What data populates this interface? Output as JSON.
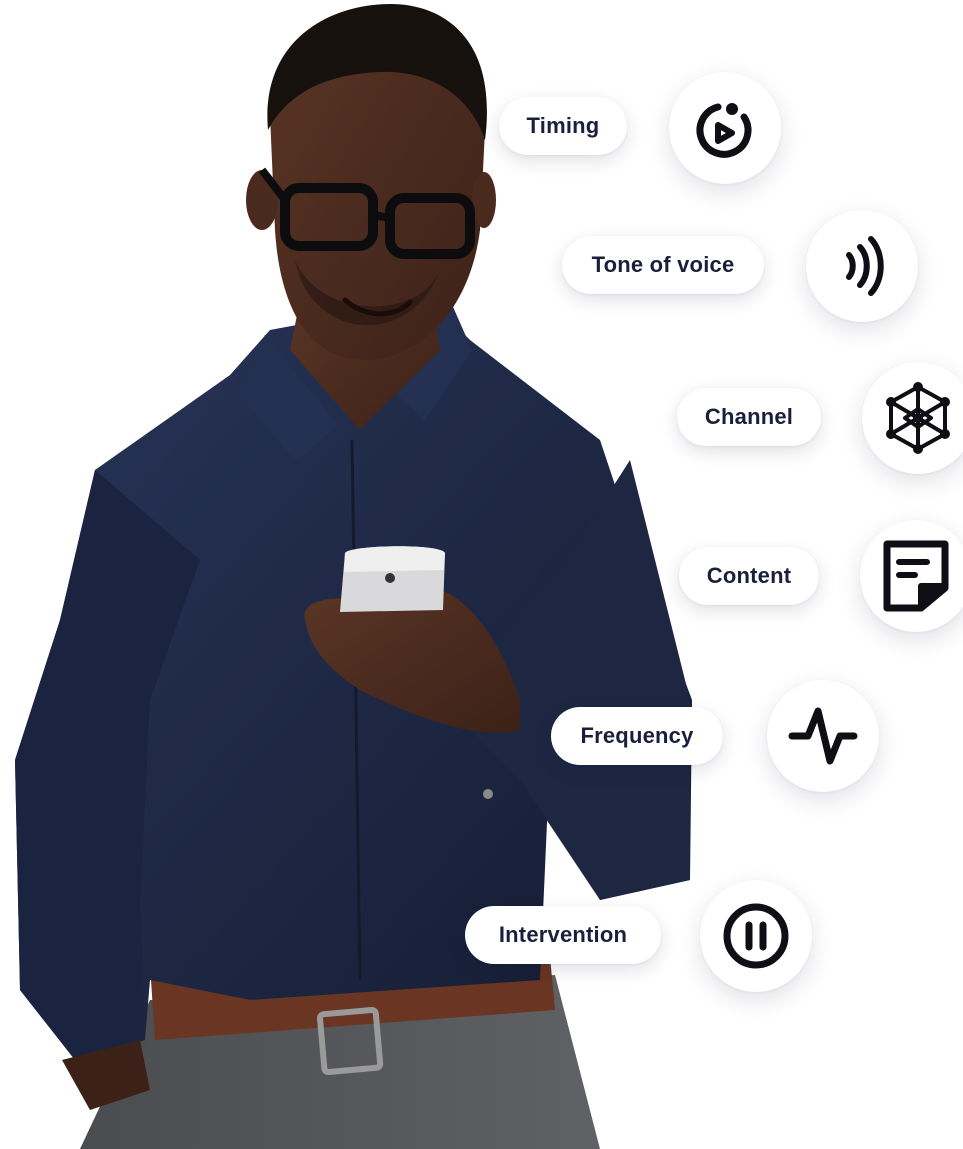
{
  "features": [
    {
      "label": "Timing",
      "icon": "stopwatch-icon"
    },
    {
      "label": "Tone of voice",
      "icon": "sound-waves-icon"
    },
    {
      "label": "Channel",
      "icon": "network-molecule-icon"
    },
    {
      "label": "Content",
      "icon": "note-document-icon"
    },
    {
      "label": "Frequency",
      "icon": "pulse-icon"
    },
    {
      "label": "Intervention",
      "icon": "pause-circle-icon"
    }
  ],
  "colors": {
    "icon_stroke": "#0e0e14",
    "pill_text": "#1b1f3b",
    "shirt": "#1d2742"
  }
}
